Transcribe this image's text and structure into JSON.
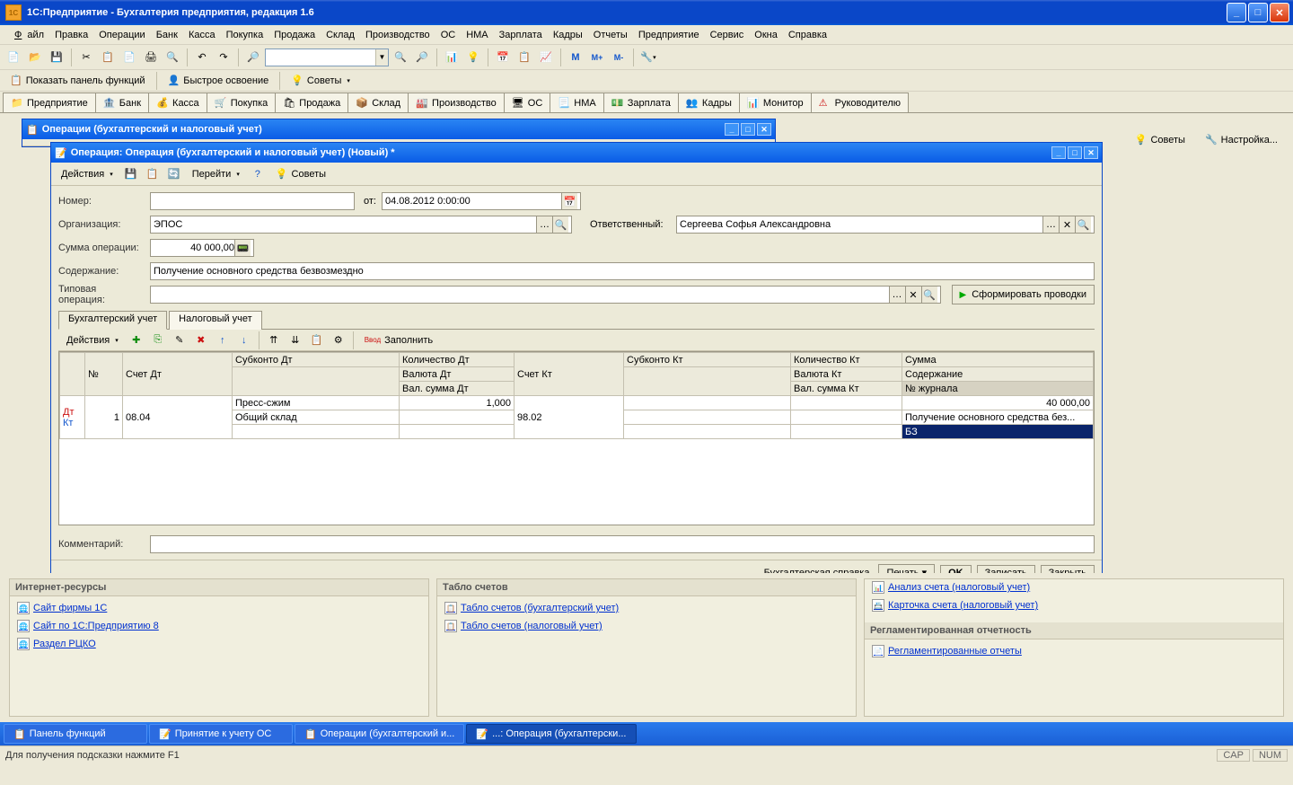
{
  "app": {
    "title": "1С:Предприятие - Бухгалтерия предприятия, редакция 1.6"
  },
  "menu": [
    "Файл",
    "Правка",
    "Операции",
    "Банк",
    "Касса",
    "Покупка",
    "Продажа",
    "Склад",
    "Производство",
    "ОС",
    "НМА",
    "Зарплата",
    "Кадры",
    "Отчеты",
    "Предприятие",
    "Сервис",
    "Окна",
    "Справка"
  ],
  "funcbar": {
    "show_panel": "Показать панель функций",
    "quick": "Быстрое освоение",
    "tips": "Советы"
  },
  "navtabs": [
    "Предприятие",
    "Банк",
    "Касса",
    "Покупка",
    "Продажа",
    "Склад",
    "Производство",
    "ОС",
    "НМА",
    "Зарплата",
    "Кадры",
    "Монитор",
    "Руководителю"
  ],
  "side": {
    "tips": "Советы",
    "settings": "Настройка..."
  },
  "mdi_back_title": "Операции (бухгалтерский и налоговый учет)",
  "mdi_front_title": "Операция: Операция (бухгалтерский и налоговый учет) (Новый) *",
  "inner_tb": {
    "actions": "Действия",
    "goto": "Перейти",
    "tips": "Советы"
  },
  "form": {
    "num_label": "Номер:",
    "from_label": "от:",
    "date": "04.08.2012  0:00:00",
    "org_label": "Организация:",
    "org": "ЭПОС",
    "resp_label": "Ответственный:",
    "resp": "Сергеева Софья Александровна",
    "sum_label": "Сумма операции:",
    "sum": "40 000,00",
    "content_label": "Содержание:",
    "content": "Получение основного средства безвозмездно",
    "typical_label": "Типовая операция:",
    "gen": "Сформировать проводки"
  },
  "subtabs": {
    "acc": "Бухгалтерский учет",
    "tax": "Налоговый учет"
  },
  "gridtb": {
    "actions": "Действия",
    "fill": "Заполнить"
  },
  "grid_headers": {
    "n": "№",
    "acc_dt": "Счет Дт",
    "sub_dt": "Субконто Дт",
    "qty_dt": "Количество Дт",
    "cur_dt": "Валюта Дт",
    "valsum_dt": "Вал. сумма Дт",
    "acc_kt": "Счет Кт",
    "sub_kt": "Субконто Кт",
    "qty_kt": "Количество Кт",
    "cur_kt": "Валюта Кт",
    "valsum_kt": "Вал. сумма Кт",
    "sum": "Сумма",
    "cont": "Содержание",
    "journal": "№ журнала"
  },
  "grid_row": {
    "n": "1",
    "acc_dt": "08.04",
    "sub_dt1": "Пресс-сжим",
    "sub_dt2": "Общий склад",
    "qty_dt": "1,000",
    "acc_kt": "98.02",
    "sum": "40 000,00",
    "cont": "Получение основного средства без...",
    "journal": "БЗ"
  },
  "comment_label": "Комментарий:",
  "footer": {
    "ref": "Бухгалтерская справка",
    "print": "Печать",
    "ok": "OK",
    "write": "Записать",
    "close": "Закрыть"
  },
  "panels": {
    "internet_h": "Интернет-ресурсы",
    "tablo_h": "Табло счетов",
    "reg_h": "Регламентированная отчетность",
    "l1": "Сайт фирмы 1С",
    "l2": "Сайт по 1С:Предприятию 8",
    "l3": "Раздел РЦКО",
    "t1": "Табло счетов (бухгалтерский учет)",
    "t2": "Табло счетов (налоговый учет)",
    "a1": "Анализ счета (налоговый учет)",
    "a2": "Карточка счета (налоговый учет)",
    "r1": "Регламентированные отчеты"
  },
  "taskbar": {
    "t1": "Панель функций",
    "t2": "Принятие к учету ОС",
    "t3": "Операции (бухгалтерский и...",
    "t4": "...: Операция (бухгалтерски..."
  },
  "status": {
    "hint": "Для получения подсказки нажмите F1",
    "cap": "CAP",
    "num": "NUM"
  }
}
